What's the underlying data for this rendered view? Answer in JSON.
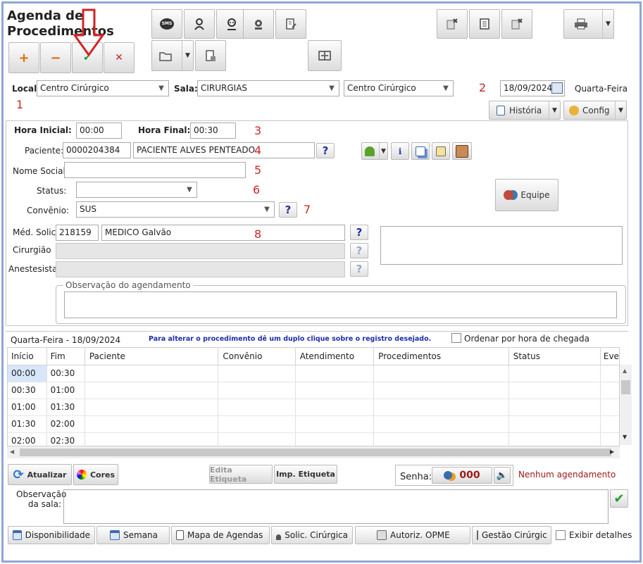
{
  "page": {
    "title": "Agenda de Procedimentos"
  },
  "actions": {
    "add": "+",
    "remove": "−",
    "confirm": "✔",
    "cancel": "✕"
  },
  "toolbar": {
    "sms": "SMS"
  },
  "location": {
    "local_label": "Local",
    "local_value": "Centro Cirúrgico",
    "sala_label": "Sala:",
    "sala_value": "CIRURGIAS",
    "center_value": "Centro Cirúrgico",
    "date": "18/09/2024",
    "weekday": "Quarta-Feira",
    "historia": "História",
    "config": "Config"
  },
  "markers": {
    "m1": "1",
    "m2": "2",
    "m3": "3",
    "m4": "4",
    "m5": "5",
    "m6": "6",
    "m7": "7",
    "m8": "8"
  },
  "form": {
    "hora_inicial_label": "Hora Inicial:",
    "hora_inicial": "00:00",
    "hora_final_label": "Hora Final:",
    "hora_final": "00:30",
    "paciente_label": "Paciente:",
    "paciente_code": "0000204384",
    "paciente_name": "PACIENTE ALVES PENTEADO",
    "nome_social_label": "Nome Social:",
    "nome_social": "",
    "status_label": "Status:",
    "status": "",
    "convenio_label": "Convênio:",
    "convenio": "SUS",
    "med_label": "Méd. Solic.",
    "med_code": "218159",
    "med_name": "MEDICO  Galvão",
    "cirurgiao_label": "Cirurgião",
    "anestesista_label": "Anestesista",
    "obs_legend": "Observação do agendamento",
    "equipe": "Equipe",
    "help": "?"
  },
  "schedule": {
    "day": "Quarta-Feira - 18/09/2024",
    "hint": "Para alterar o procedimento dê um duplo clique sobre o registro desejado.",
    "order_label": "Ordenar por hora de chegada",
    "columns": [
      "Início",
      "Fim",
      "Paciente",
      "Convênio",
      "Atendimento",
      "Procedimentos",
      "Status",
      "Eve"
    ],
    "rows": [
      [
        "00:00",
        "00:30"
      ],
      [
        "00:30",
        "01:00"
      ],
      [
        "01:00",
        "01:30"
      ],
      [
        "01:30",
        "02:00"
      ],
      [
        "02:00",
        "02:30"
      ]
    ]
  },
  "footer": {
    "atualizar": "Atualizar",
    "cores": "Cores",
    "edita": "Edita Etiqueta",
    "imp": "Imp. Etiqueta",
    "senha_label": "Senha:",
    "senha_value": "000",
    "status": "Nenhum agendamento",
    "obs_sala_label_1": "Observação",
    "obs_sala_label_2": "da sala:",
    "obs_sala": "",
    "disponibilidade": "Disponibilidade",
    "semana": "Semana",
    "mapa": "Mapa de Agendas",
    "solic": "Solic. Cirúrgica",
    "autoriz": "Autoriz. OPME",
    "gestao": "Gestão Cirúrgic",
    "exibir": "Exibir detalhes"
  },
  "colors": {
    "accent": "#d02525",
    "frame": "#8fa5d8",
    "link": "#1e2fa8"
  }
}
